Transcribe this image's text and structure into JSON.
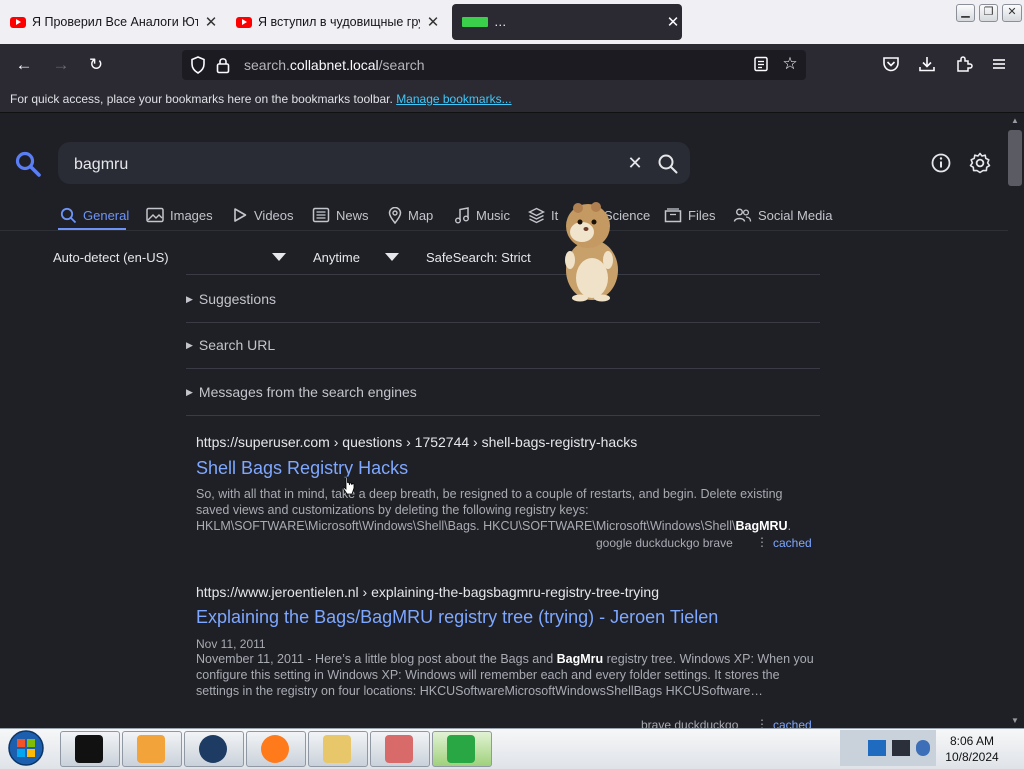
{
  "browser": {
    "tabs": [
      {
        "title": "Я Проверил Все Аналоги Ютуб",
        "close": "✕"
      },
      {
        "title": "Я вступил в чудовищные груп",
        "close": "✕"
      },
      {
        "title": "…",
        "close": "✕"
      }
    ],
    "window_controls": {
      "minimize": "▁",
      "restore": "❐",
      "close": "✕"
    },
    "url_prefix": "search.",
    "url_domain": "collabnet.local",
    "url_path": "/search",
    "bookmarks_text": "For quick access, place your bookmarks here on the bookmarks toolbar. ",
    "bookmarks_link": "Manage bookmarks..."
  },
  "search": {
    "query": "bagmru",
    "clear_label": "✕"
  },
  "categories": [
    {
      "label": "General",
      "icon": "search-icon"
    },
    {
      "label": "Images",
      "icon": "image-icon"
    },
    {
      "label": "Videos",
      "icon": "play-icon"
    },
    {
      "label": "News",
      "icon": "newspaper-icon"
    },
    {
      "label": "Map",
      "icon": "map-pin-icon"
    },
    {
      "label": "Music",
      "icon": "music-icon"
    },
    {
      "label": "It",
      "icon": "layers-icon"
    },
    {
      "label": "Science",
      "icon": "flask-icon"
    },
    {
      "label": "Files",
      "icon": "files-icon"
    },
    {
      "label": "Social Media",
      "icon": "people-icon"
    }
  ],
  "filters": {
    "language": "Auto-detect (en-US)",
    "time": "Anytime",
    "safesearch": "SafeSearch: Strict"
  },
  "accordions": [
    "Suggestions",
    "Search URL",
    "Messages from the search engines"
  ],
  "results": [
    {
      "url_host": "https://superuser.com",
      "url_path": " › questions › 1752744 › shell-bags-registry-hacks",
      "title": "Shell Bags Registry Hacks",
      "body_before": "So, with all that in mind, take a deep breath, be resigned to a couple of restarts, and begin. Delete existing saved views and customizations by deleting the following registry keys: HKLM\\SOFTWARE\\Microsoft\\Windows\\Shell\\Bags. HKCU\\SOFTWARE\\Microsoft\\Windows\\Shell\\",
      "body_bold": "BagMRU",
      "body_after": ".",
      "engines": "google  duckduckgo  brave",
      "cached": "cached"
    },
    {
      "url_host": "https://www.jeroentielen.nl",
      "url_path": " › explaining-the-bagsbagmru-registry-tree-trying",
      "title": "Explaining the Bags/BagMRU registry tree (trying) - Jeroen Tielen",
      "date": "Nov 11, 2011",
      "body_before": "November 11, 2011 - Here’s a little blog post about the Bags and ",
      "body_bold": "BagMru",
      "body_after": " registry tree. Windows XP: When you configure this setting in Windows XP: Windows will remember each and every folder settings. It stores the settings in the registry on four locations: HKCUSoftwareMicrosoftWindowsShellBags HKCUSoftware…",
      "engines": "brave  duckduckgo",
      "cached": "cached"
    }
  ],
  "taskbar": {
    "time": "8:06 AM",
    "date": "10/8/2024"
  },
  "colors": {
    "accent": "#6e93f7",
    "link": "#7ea7ff",
    "background": "#1f2026"
  }
}
